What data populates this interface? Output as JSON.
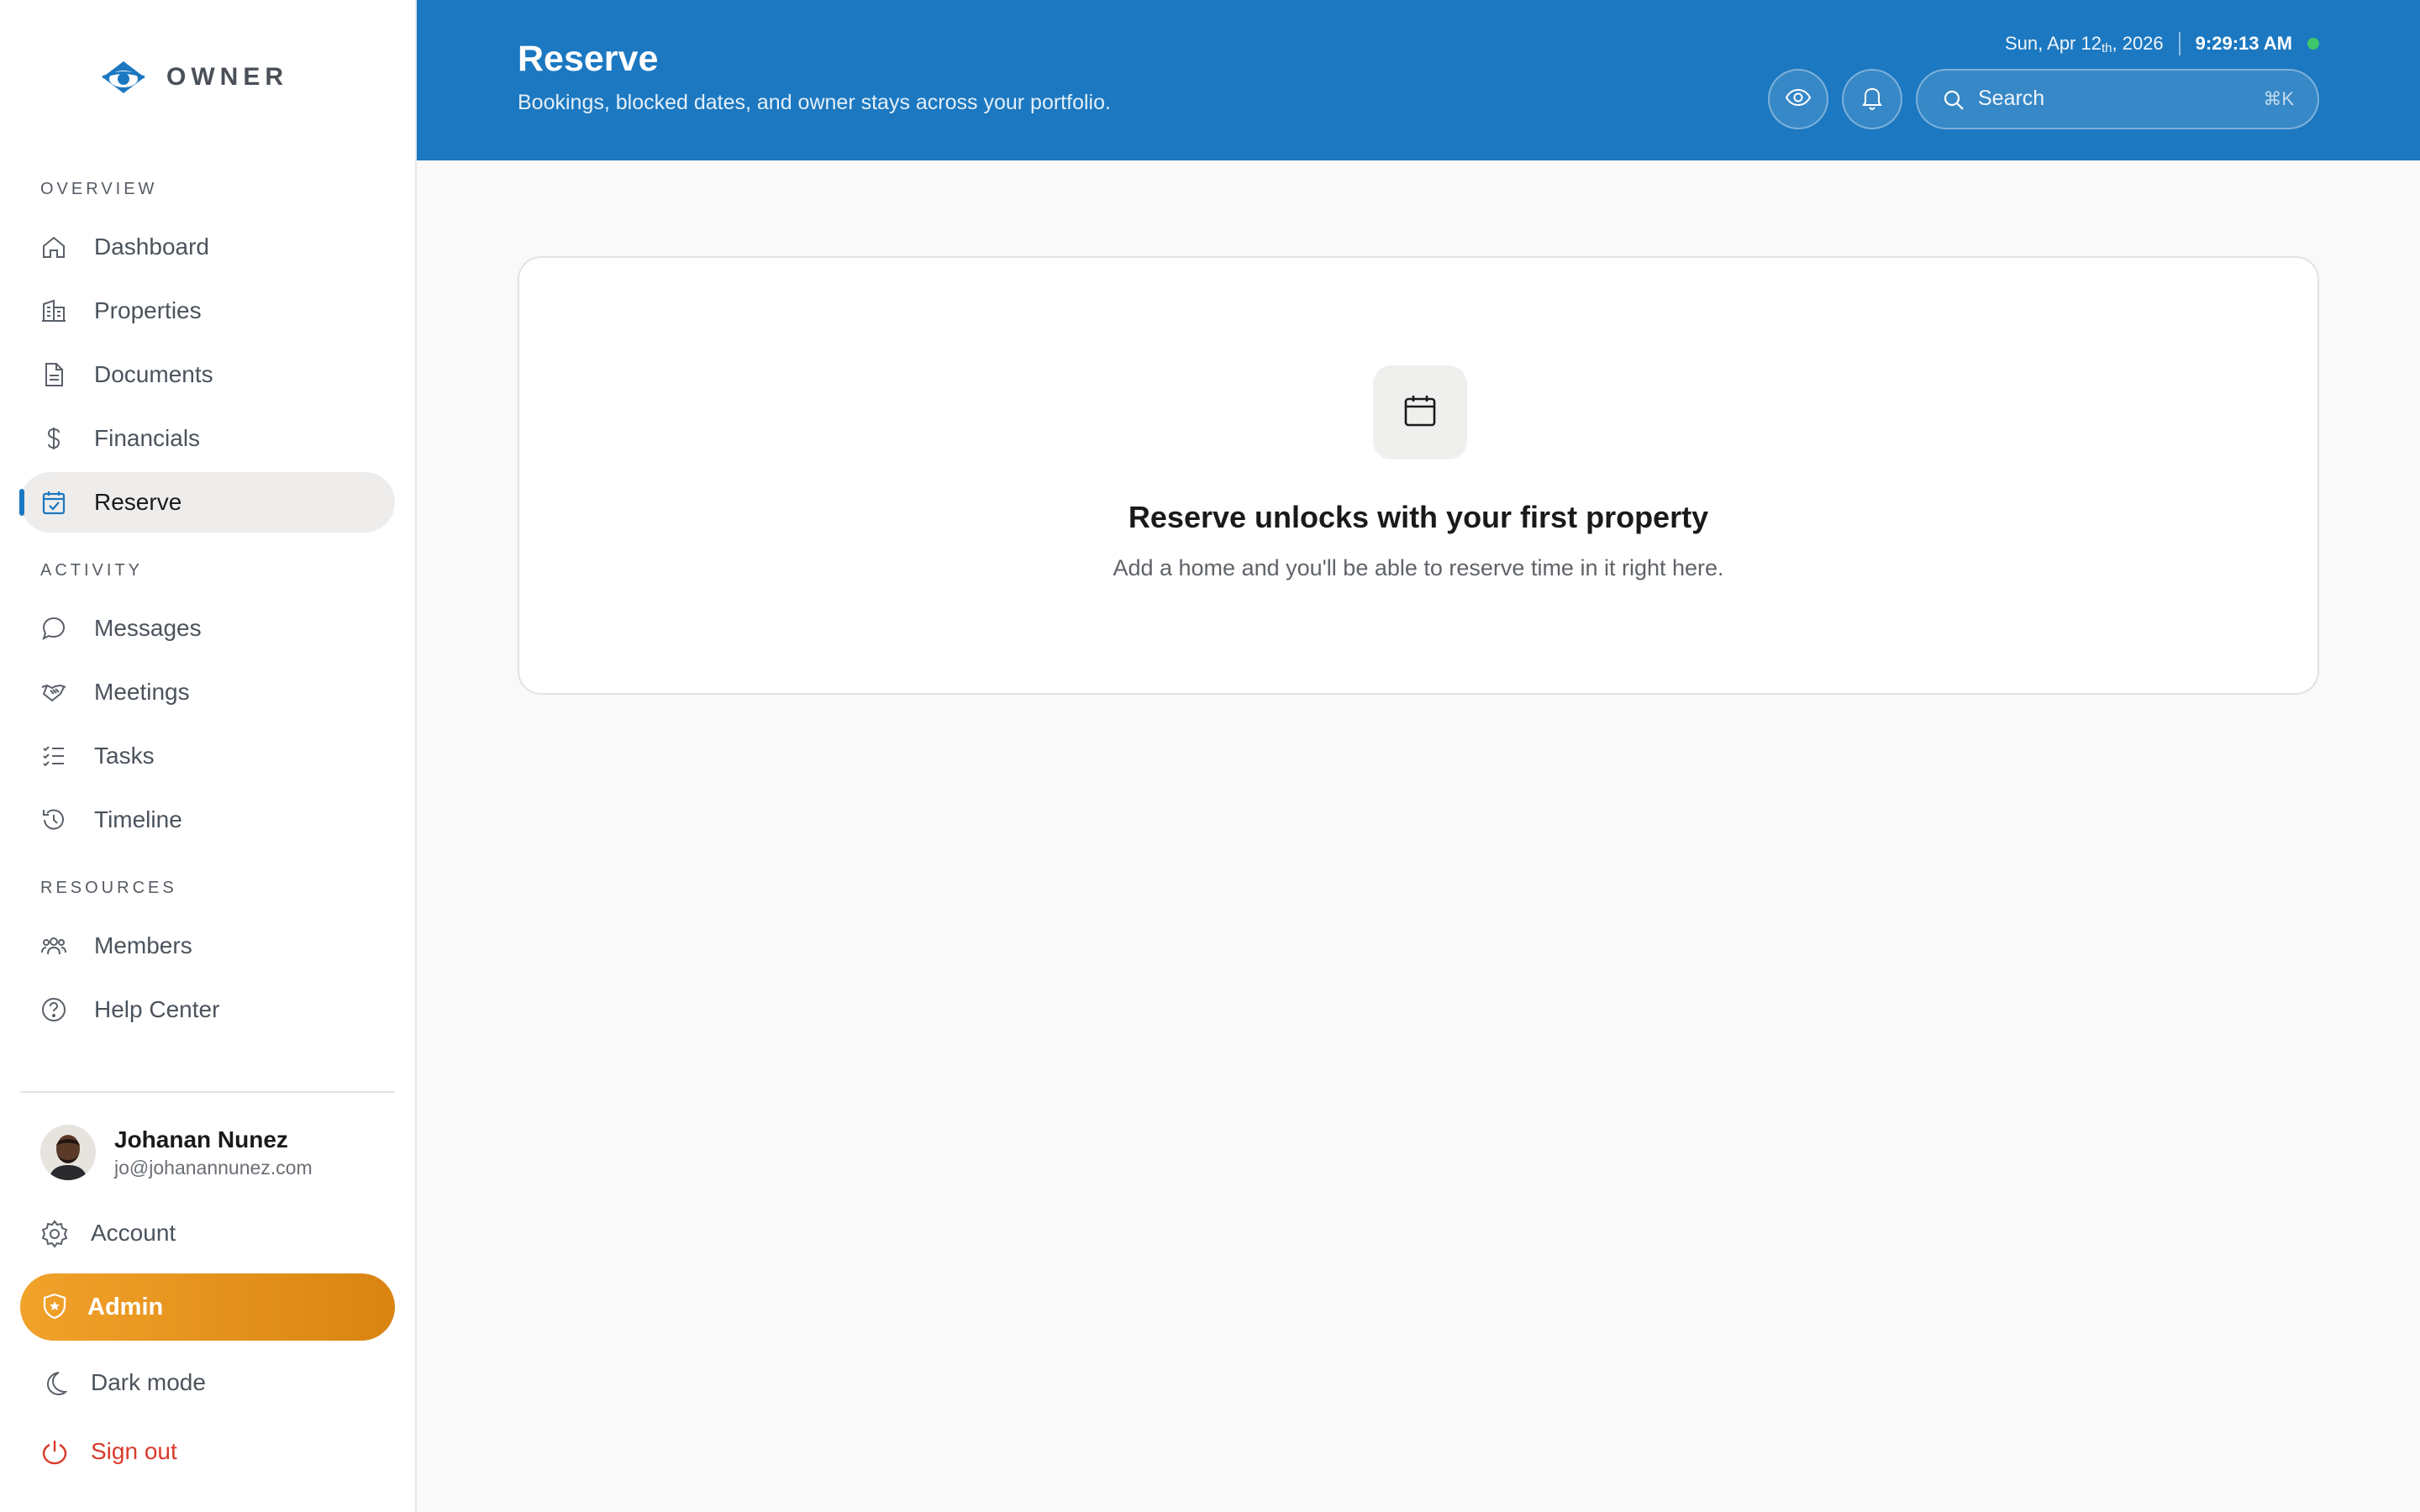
{
  "brand": {
    "name": "OWNER",
    "accent": "#1c78c0"
  },
  "sidebar": {
    "sections": {
      "overview": "OVERVIEW",
      "activity": "ACTIVITY",
      "resources": "RESOURCES"
    },
    "items": [
      {
        "label": "Dashboard",
        "icon": "home-icon"
      },
      {
        "label": "Properties",
        "icon": "building-icon"
      },
      {
        "label": "Documents",
        "icon": "document-icon"
      },
      {
        "label": "Financials",
        "icon": "dollar-icon"
      },
      {
        "label": "Reserve",
        "icon": "calendar-check-icon",
        "active": true
      },
      {
        "label": "Messages",
        "icon": "chat-bubble-icon"
      },
      {
        "label": "Meetings",
        "icon": "handshake-icon"
      },
      {
        "label": "Tasks",
        "icon": "checklist-icon"
      },
      {
        "label": "Timeline",
        "icon": "history-icon"
      },
      {
        "label": "Members",
        "icon": "users-icon"
      },
      {
        "label": "Help Center",
        "icon": "help-circle-icon"
      }
    ],
    "user": {
      "name": "Johanan Nunez",
      "email": "jo@johanannunez.com"
    },
    "bottom": {
      "account": "Account",
      "admin": "Admin",
      "dark_mode": "Dark mode",
      "sign_out": "Sign out"
    }
  },
  "header": {
    "title": "Reserve",
    "subtitle": "Bookings, blocked dates, and owner stays across your portfolio.",
    "date_prefix": "Sun, Apr 12",
    "date_suffix": "th",
    "date_year": ", 2026",
    "time": "9:29:13 AM",
    "search_placeholder": "Search",
    "search_shortcut": "⌘K"
  },
  "empty_state": {
    "icon": "calendar-icon",
    "title": "Reserve unlocks with your first property",
    "text": "Add a home and you'll be able to reserve time in it right here."
  },
  "colors": {
    "header_bg": "#1c78c0",
    "admin_gradient_start": "#f1a22a",
    "admin_gradient_end": "#d98412",
    "sign_out": "#d93a2b",
    "status_dot": "#3ec76b"
  }
}
